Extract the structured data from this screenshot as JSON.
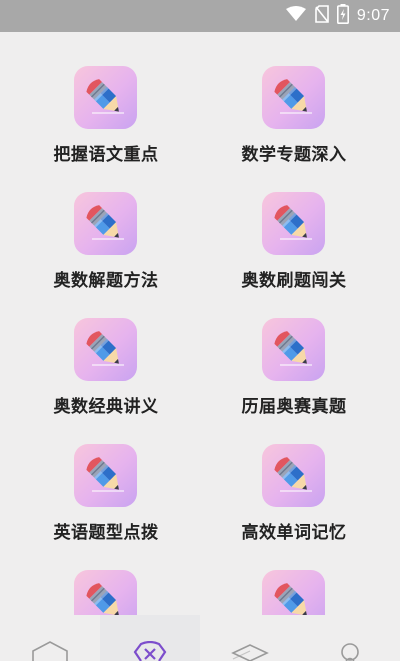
{
  "status_bar": {
    "time": "9:07",
    "icons": [
      "wifi-icon",
      "no-sim-icon",
      "battery-charging-icon"
    ]
  },
  "grid": {
    "items": [
      {
        "label": "把握语文重点",
        "icon": "pencil-icon"
      },
      {
        "label": "数学专题深入",
        "icon": "pencil-icon"
      },
      {
        "label": "奥数解题方法",
        "icon": "pencil-icon"
      },
      {
        "label": "奥数刷题闯关",
        "icon": "pencil-icon"
      },
      {
        "label": "奥数经典讲义",
        "icon": "pencil-icon"
      },
      {
        "label": "历届奥赛真题",
        "icon": "pencil-icon"
      },
      {
        "label": "英语题型点拨",
        "icon": "pencil-icon"
      },
      {
        "label": "高效单词记忆",
        "icon": "pencil-icon"
      },
      {
        "label": "",
        "icon": "pencil-icon"
      },
      {
        "label": "",
        "icon": "pencil-icon"
      }
    ]
  },
  "bottom_nav": {
    "tabs": [
      {
        "icon": "home-icon",
        "active": false
      },
      {
        "icon": "hexagon-x-icon",
        "active": true
      },
      {
        "icon": "layers-icon",
        "active": false
      },
      {
        "icon": "profile-icon",
        "active": false
      }
    ],
    "active_color": "#7c4dcc",
    "inactive_color": "#9a9a9a"
  },
  "colors": {
    "background": "#efeeee",
    "status_bar": "#a8a8a8",
    "label_text": "#222222"
  }
}
